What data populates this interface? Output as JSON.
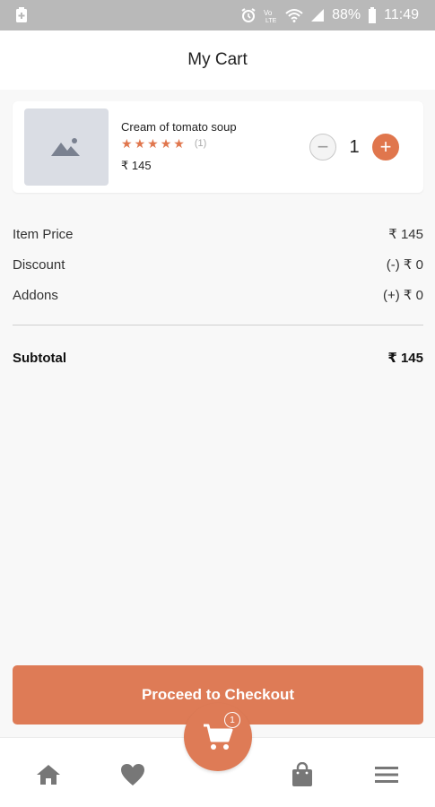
{
  "status_bar": {
    "battery_percent": "88%",
    "time": "11:49"
  },
  "header": {
    "title": "My Cart"
  },
  "cart_item": {
    "name": "Cream of tomato soup",
    "rating_stars": 5,
    "rating_count": "(1)",
    "price": "₹ 145",
    "quantity": "1",
    "minus_label": "−",
    "plus_label": "+"
  },
  "summary": {
    "item_price_label": "Item Price",
    "item_price_value": "₹ 145",
    "discount_label": "Discount",
    "discount_value": "(-) ₹ 0",
    "addons_label": "Addons",
    "addons_value": "(+) ₹ 0",
    "subtotal_label": "Subtotal",
    "subtotal_value": "₹ 145"
  },
  "checkout": {
    "label": "Proceed to Checkout"
  },
  "bottom_nav": {
    "cart_badge": "1",
    "items": [
      "home-icon",
      "heart-icon",
      "cart-icon",
      "bag-icon",
      "menu-icon"
    ]
  },
  "colors": {
    "accent": "#de7b56",
    "status_bar": "#b9b9b9",
    "background": "#f8f8f8"
  }
}
